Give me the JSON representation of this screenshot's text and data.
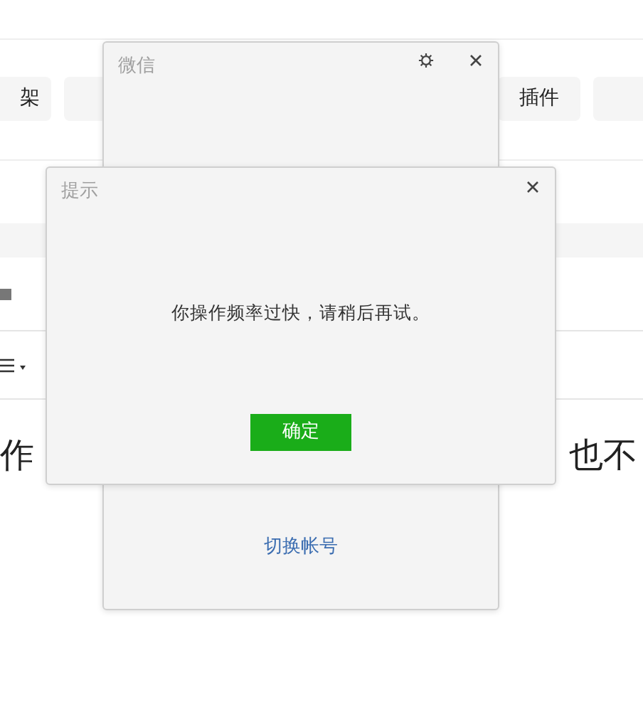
{
  "background_page": {
    "tags": [
      {
        "kind": "text",
        "label": "架"
      },
      {
        "kind": "covered"
      },
      {
        "kind": "text",
        "label": "插件"
      },
      {
        "kind": "covered"
      }
    ],
    "headline_left": "作",
    "headline_right": "也不"
  },
  "wechat_window": {
    "title": "微信",
    "link": "切换帐号"
  },
  "dialog": {
    "title": "提示",
    "message": "你操作频率过快，请稍后再试。",
    "button": "确定"
  }
}
